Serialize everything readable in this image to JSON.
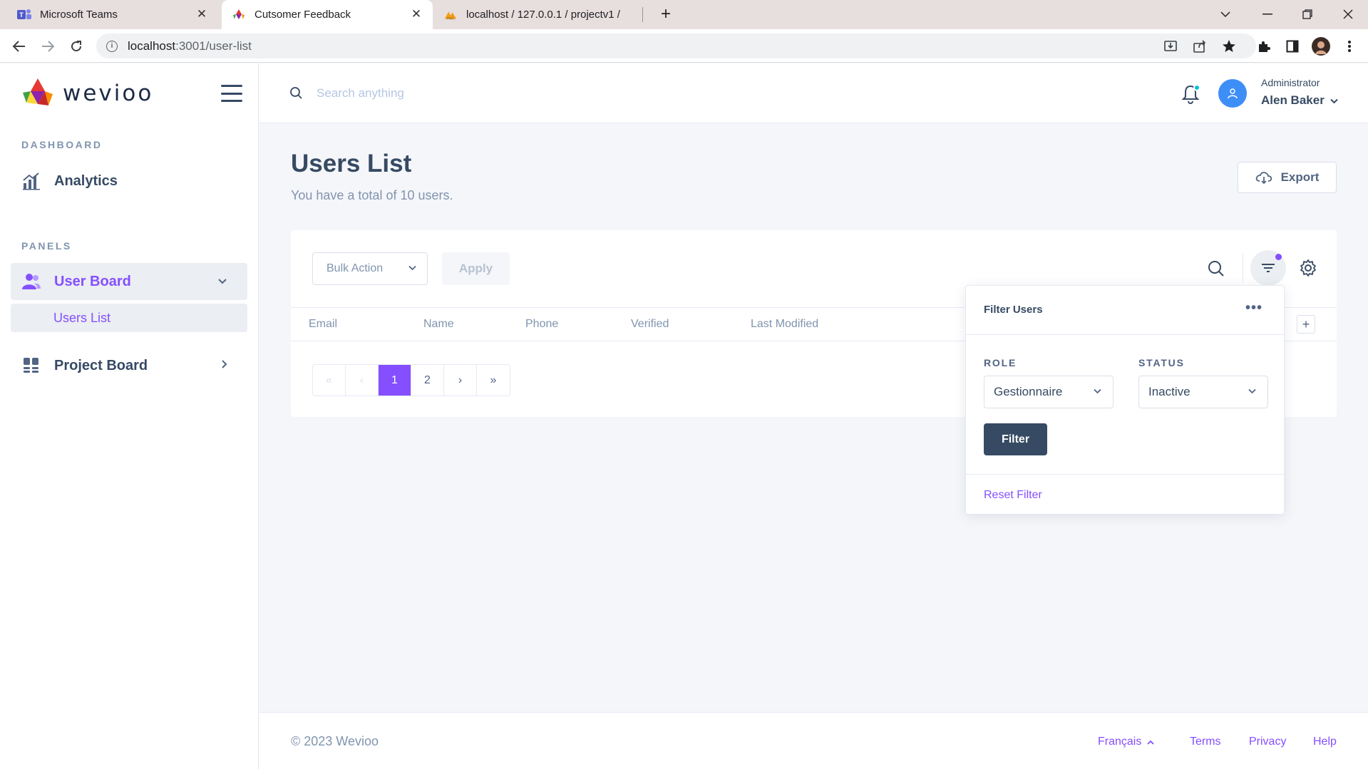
{
  "browser": {
    "tabs": [
      {
        "title": "Microsoft Teams",
        "icon": "teams-icon"
      },
      {
        "title": "Cutsomer Feedback",
        "icon": "wevioo-favicon"
      },
      {
        "title": "localhost / 127.0.0.1 / projectv1 /",
        "icon": "phpmyadmin-icon"
      }
    ],
    "url_host": "localhost",
    "url_path": ":3001/user-list"
  },
  "brand": {
    "name": "wevioo"
  },
  "sidebar": {
    "dashboard_title": "DASHBOARD",
    "analytics_label": "Analytics",
    "panels_title": "PANELS",
    "user_board_label": "User Board",
    "users_list_label": "Users List",
    "project_board_label": "Project Board"
  },
  "topbar": {
    "search_placeholder": "Search anything",
    "user_role": "Administrator",
    "user_name": "Alen Baker"
  },
  "page": {
    "title": "Users List",
    "subtitle": "You have a total of 10 users.",
    "export_label": "Export"
  },
  "toolbar": {
    "bulk_action_label": "Bulk Action",
    "apply_label": "Apply"
  },
  "table": {
    "columns": [
      "Email",
      "Name",
      "Phone",
      "Verified",
      "Last Modified"
    ]
  },
  "pagination": {
    "first": "«",
    "prev": "‹",
    "pages": [
      "1",
      "2"
    ],
    "current_page": "1",
    "next": "›",
    "last": "»"
  },
  "filter": {
    "title": "Filter Users",
    "more": "•••",
    "role_label": "ROLE",
    "role_value": "Gestionnaire",
    "status_label": "STATUS",
    "status_value": "Inactive",
    "filter_button": "Filter",
    "reset_label": "Reset Filter"
  },
  "footer": {
    "copyright": "© 2023 Wevioo",
    "language": "Français",
    "terms": "Terms",
    "privacy": "Privacy",
    "help": "Help"
  },
  "colors": {
    "accent": "#854fff",
    "text": "#364a63",
    "muted": "#8094ae",
    "avatar": "#3e8ef7",
    "notification_dot": "#09c2de"
  }
}
